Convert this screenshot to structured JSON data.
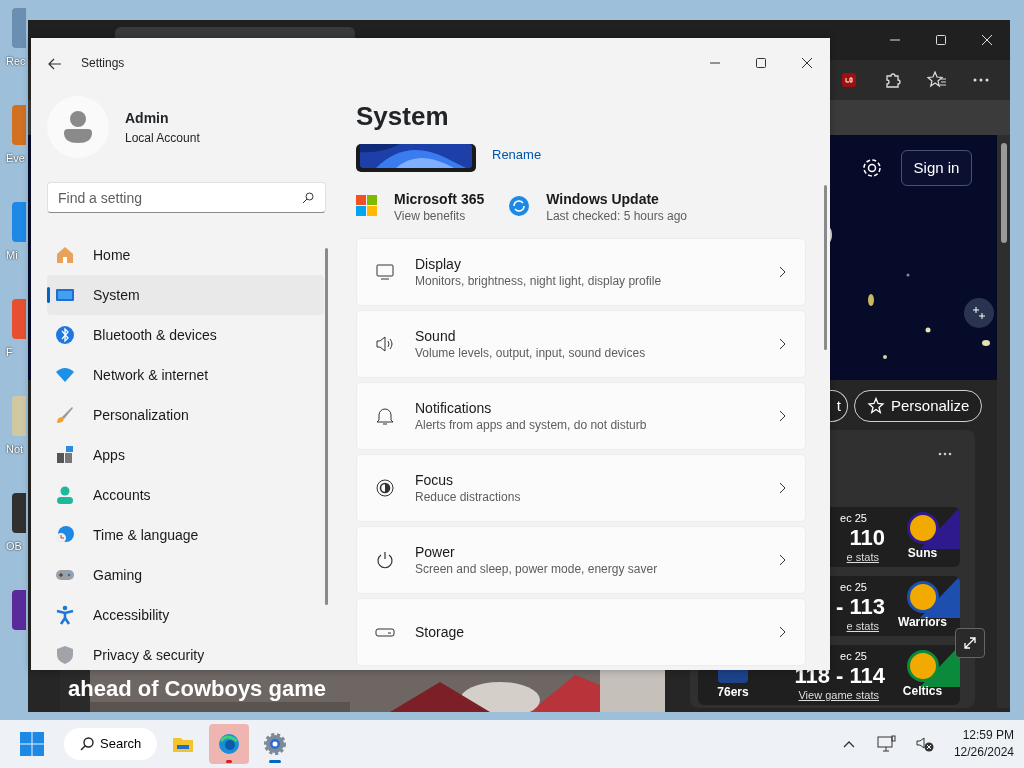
{
  "desktop_icons": [
    {
      "label": "Rec"
    },
    {
      "label": "Eve"
    },
    {
      "label": "Mi"
    },
    {
      "label": "F"
    },
    {
      "label": "Not"
    },
    {
      "label": "OB"
    }
  ],
  "browser": {
    "sign_in": "Sign in",
    "left_button": "t",
    "personalize": "Personalize",
    "headline": "ahead of Cowboys game",
    "scores": [
      {
        "date": "ec 25",
        "score": "110",
        "stats": "e stats",
        "team": "Suns",
        "color": "#2e1a8c"
      },
      {
        "date": "ec 25",
        "score": "- 113",
        "stats": "e stats",
        "team": "Warriors",
        "color": "#1d4fb0"
      },
      {
        "date": "ec 25",
        "score": "118 - 114",
        "stats": "View game stats",
        "team": "Celtics",
        "color": "#0b8a3c",
        "away": "76ers"
      }
    ]
  },
  "settings": {
    "title": "Settings",
    "user": {
      "name": "Admin",
      "account": "Local Account"
    },
    "search": {
      "placeholder": "Find a setting"
    },
    "nav": [
      {
        "label": "Home",
        "selected": false
      },
      {
        "label": "System",
        "selected": true
      },
      {
        "label": "Bluetooth & devices",
        "selected": false
      },
      {
        "label": "Network & internet",
        "selected": false
      },
      {
        "label": "Personalization",
        "selected": false
      },
      {
        "label": "Apps",
        "selected": false
      },
      {
        "label": "Accounts",
        "selected": false
      },
      {
        "label": "Time & language",
        "selected": false
      },
      {
        "label": "Gaming",
        "selected": false
      },
      {
        "label": "Accessibility",
        "selected": false
      },
      {
        "label": "Privacy & security",
        "selected": false
      }
    ],
    "heading": "System",
    "rename": "Rename",
    "tiles": [
      {
        "title": "Microsoft 365",
        "subtitle": "View benefits"
      },
      {
        "title": "Windows Update",
        "subtitle": "Last checked: 5 hours ago"
      }
    ],
    "items": [
      {
        "title": "Display",
        "subtitle": "Monitors, brightness, night light, display profile"
      },
      {
        "title": "Sound",
        "subtitle": "Volume levels, output, input, sound devices"
      },
      {
        "title": "Notifications",
        "subtitle": "Alerts from apps and system, do not disturb"
      },
      {
        "title": "Focus",
        "subtitle": "Reduce distractions"
      },
      {
        "title": "Power",
        "subtitle": "Screen and sleep, power mode, energy saver"
      },
      {
        "title": "Storage"
      }
    ]
  },
  "taskbar": {
    "search": "Search",
    "apps": [
      {
        "kind": "folder",
        "active": false,
        "attention": false
      },
      {
        "kind": "edge",
        "active": false,
        "attention": true
      },
      {
        "kind": "settings",
        "active": true,
        "attention": false
      }
    ],
    "time": "12:59 PM",
    "date": "12/26/2024"
  }
}
